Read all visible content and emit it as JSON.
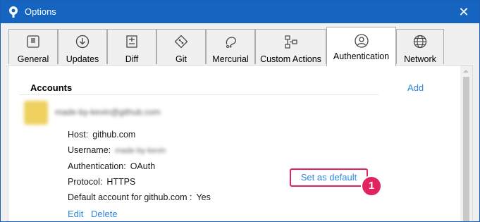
{
  "window": {
    "title": "Options"
  },
  "tabs": [
    {
      "label": "General",
      "icon": "toggle-icon"
    },
    {
      "label": "Updates",
      "icon": "download-icon"
    },
    {
      "label": "Diff",
      "icon": "diff-icon"
    },
    {
      "label": "Git",
      "icon": "git-icon"
    },
    {
      "label": "Mercurial",
      "icon": "mercurial-icon"
    },
    {
      "label": "Custom Actions",
      "icon": "flow-icon"
    },
    {
      "label": "Authentication",
      "icon": "user-icon",
      "active": true
    },
    {
      "label": "Network",
      "icon": "globe-icon"
    }
  ],
  "accounts": {
    "heading": "Accounts",
    "add_label": "Add",
    "account_name": "made-by-kevin@github.com",
    "host_key": "Host:",
    "host_value": "github.com",
    "username_key": "Username:",
    "username_value": "made-by-kevin",
    "auth_key": "Authentication:",
    "auth_value": "OAuth",
    "protocol_key": "Protocol:",
    "protocol_value": "HTTPS",
    "default_key": "Default account for github.com :",
    "default_value": "Yes",
    "set_default_label": "Set as default",
    "edit_label": "Edit",
    "delete_label": "Delete"
  },
  "callout": {
    "number": "1",
    "color": "#e0245e"
  },
  "colors": {
    "titlebar": "#1565c0",
    "link": "#2e86de",
    "highlight": "#e0245e"
  }
}
